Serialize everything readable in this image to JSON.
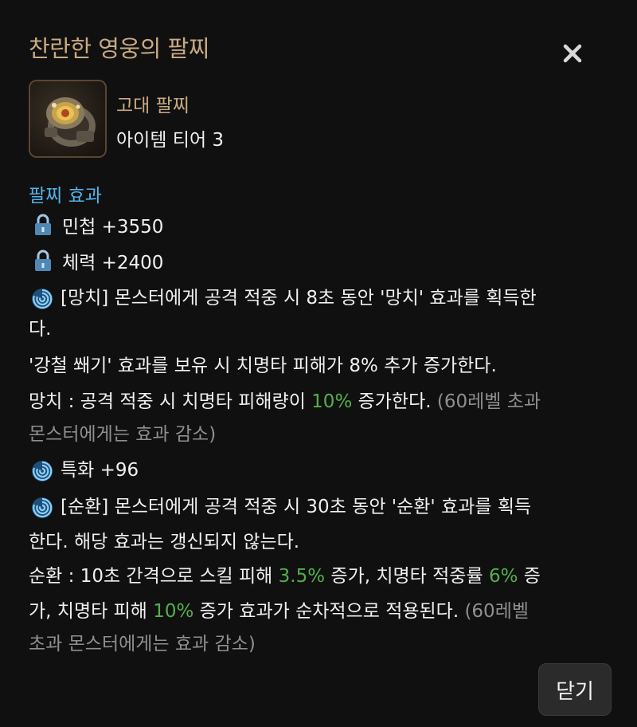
{
  "dialog": {
    "title": "찬란한 영웅의 팔찌",
    "close_icon": "close-icon",
    "close_button_label": "닫기"
  },
  "item": {
    "icon": "bracelet-icon",
    "grade": "고대 팔찌",
    "tier": "아이템 티어 3"
  },
  "effects": {
    "heading": "팔찌 효과",
    "heading_color": "#4fb3e8",
    "stat1": {
      "icon": "lock-icon",
      "text": "민첩 +3550"
    },
    "stat2": {
      "icon": "lock-icon",
      "text": "체력 +2400"
    },
    "effect1": {
      "icon": "swirl-icon",
      "line1": "[망치] 몬스터에게 공격 적중 시 8초 동안 '망치' 효과를 획득한",
      "line2": "다.",
      "line3": "'강철 쐐기' 효과를 보유 시 치명타 피해가 8% 추가 증가한다.",
      "line4_a": "망치 : 공격 적중 시 치명타 피해량이 ",
      "line4_val": "10%",
      "line4_b": " 증가한다. ",
      "line4_note": "(60레벨 초과",
      "line5_note": "몬스터에게는 효과 감소)"
    },
    "stat3": {
      "icon": "swirl-icon",
      "text": "특화 +96"
    },
    "effect2": {
      "icon": "swirl-icon",
      "line1": "[순환] 몬스터에게 공격 적중 시 30초 동안 '순환' 효과를 획득",
      "line2": "한다. 해당 효과는 갱신되지 않는다.",
      "line3_a": "순환 : 10초 간격으로 스킬 피해 ",
      "line3_val1": "3.5%",
      "line3_b": " 증가, 치명타 적중률 ",
      "line3_val2": "6%",
      "line3_c": " 증",
      "line4_a": "가, 치명타 피해 ",
      "line4_val": "10%",
      "line4_b": " 증가 효과가 순차적으로 적용된다. ",
      "line4_note": "(60레벨",
      "line5_note": "초과 몬스터에게는 효과 감소)"
    }
  },
  "colors": {
    "title": "#c8aa82",
    "highlight_green": "#52b04a",
    "note_gray": "#8f8f8f"
  }
}
